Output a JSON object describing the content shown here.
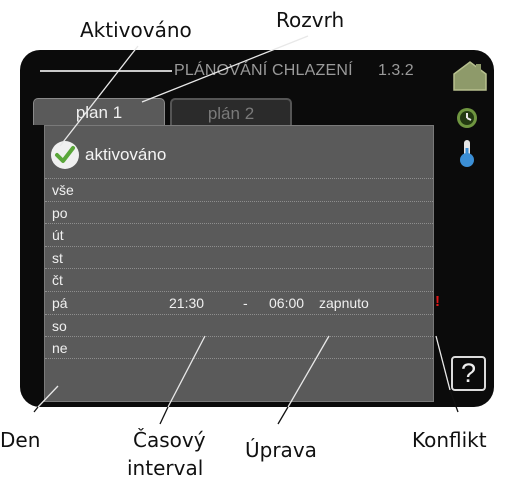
{
  "callouts": {
    "aktivovano": "Aktivováno",
    "rozvrh": "Rozvrh",
    "den": "Den",
    "casovy": "Časový",
    "interval": "interval",
    "uprava": "Úprava",
    "konflikt": "Konflikt"
  },
  "header": {
    "title": "PLÁNOVÁNÍ CHLAZENÍ",
    "menu_number": "1.3.2"
  },
  "tabs": [
    {
      "label": "plan 1",
      "active": true
    },
    {
      "label": "plán 2",
      "active": false
    }
  ],
  "activated": {
    "label": "aktivováno",
    "checked": true
  },
  "rows": [
    {
      "day": "vše",
      "start": "",
      "separator": "",
      "end": "",
      "setting": "",
      "conflict": ""
    },
    {
      "day": "po",
      "start": "",
      "separator": "",
      "end": "",
      "setting": "",
      "conflict": ""
    },
    {
      "day": "út",
      "start": "",
      "separator": "",
      "end": "",
      "setting": "",
      "conflict": ""
    },
    {
      "day": "st",
      "start": "",
      "separator": "",
      "end": "",
      "setting": "",
      "conflict": ""
    },
    {
      "day": "čt",
      "start": "",
      "separator": "",
      "end": "",
      "setting": "",
      "conflict": ""
    },
    {
      "day": "pá",
      "start": "21:30",
      "separator": "-",
      "end": "06:00",
      "setting": "zapnuto",
      "conflict": "!"
    },
    {
      "day": "so",
      "start": "",
      "separator": "",
      "end": "",
      "setting": "",
      "conflict": ""
    },
    {
      "day": "ne",
      "start": "",
      "separator": "",
      "end": "",
      "setting": "",
      "conflict": ""
    }
  ],
  "help": {
    "label": "?"
  },
  "icons": {
    "house": "house-icon",
    "clock": "clock-icon",
    "thermometer": "thermometer-icon",
    "check": "check-icon",
    "help": "help-icon"
  },
  "colors": {
    "screen_bg": "#0b0b0b",
    "panel_bg": "#5a5a5a",
    "house": "#8e9a6a",
    "clock": "#6f9640",
    "thermometer": "#3b8fd6",
    "check": "#5aa63a",
    "conflict": "#e01818",
    "title": "#9a9a9a"
  }
}
